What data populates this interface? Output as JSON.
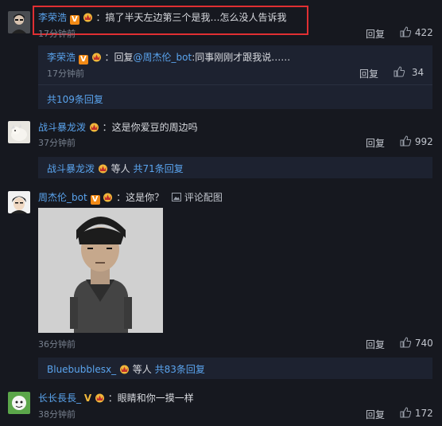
{
  "comments": [
    {
      "username": "李荣浩",
      "text": "：搞了半天左边第三个是我…怎么没人告诉我",
      "time": "17分钟前",
      "reply_label": "回复",
      "likes": "422",
      "nested": {
        "username": "李荣浩",
        "reply_prefix": "：回复",
        "mention": "@周杰伦_bot",
        "text": ":同事刚刚才跟我说……",
        "time": "17分钟前",
        "reply_label": "回复",
        "likes": "34"
      },
      "more_replies": "共109条回复"
    },
    {
      "username": "战斗暴龙泼",
      "text": "：这是你爱豆的周边吗",
      "time": "37分钟前",
      "reply_label": "回复",
      "likes": "992",
      "summary_user": "战斗暴龙泼",
      "summary_mid": "等人",
      "summary_count": "共71条回复"
    },
    {
      "username": "周杰伦_bot",
      "text": "：这是你？",
      "image_link": "评论配图",
      "time": "36分钟前",
      "reply_label": "回复",
      "likes": "740",
      "summary_user": "Bluebubblesx_",
      "summary_mid": "等人",
      "summary_count": "共83条回复"
    },
    {
      "username": "长长長長_",
      "text": "：眼睛和你一摸一样",
      "time": "38分钟前",
      "reply_label": "回复",
      "likes": "172"
    }
  ],
  "colors": {
    "background": "#16181f",
    "username": "#5aa4ee",
    "highlight": "#e02f32",
    "v_badge": "#f28a16"
  }
}
